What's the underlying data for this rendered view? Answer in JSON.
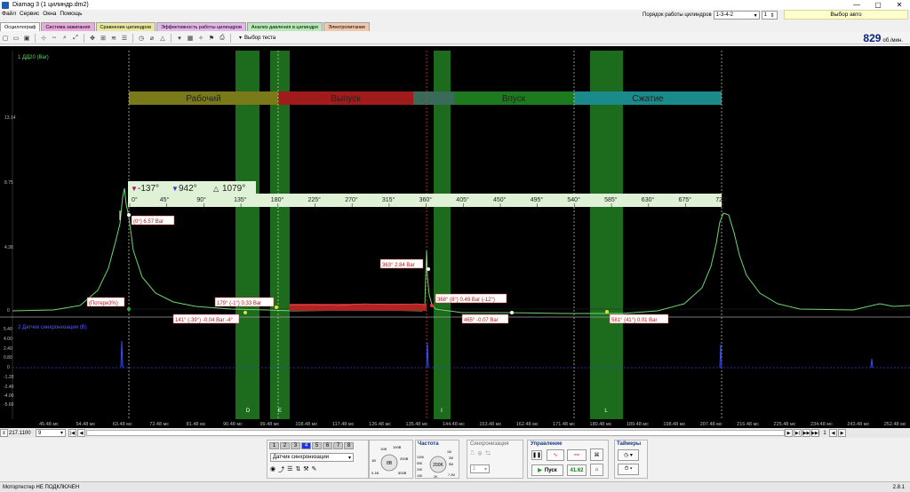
{
  "window": {
    "title": "Diamag 3 (1 цилиндр.dm2)",
    "controls": [
      "—",
      "▢",
      "✕"
    ]
  },
  "menu": [
    "Файл",
    "Сервис",
    "Окна",
    "Помощь"
  ],
  "cylinder_order": {
    "label": "Порядок работы цилиндров",
    "value": "1-3-4-2",
    "cylinder": "1",
    "auto_label": "Выбор авто"
  },
  "tabs": [
    {
      "label": "Осциллограф",
      "color": "#ffffff"
    },
    {
      "label": "Система зажигания",
      "color": "#e9a9dc"
    },
    {
      "label": "Сравнение цилиндров",
      "color": "#e8e8a0"
    },
    {
      "label": "Эффективность работы цилиндров",
      "color": "#e3b8e8"
    },
    {
      "label": "Анализ давления в цилиндре",
      "color": "#b8e8b8"
    },
    {
      "label": "Электропитание",
      "color": "#f0c8b0"
    }
  ],
  "toolbar": {
    "test_select": "Выбор теста"
  },
  "rpm": {
    "value": "829",
    "unit": "об./мин."
  },
  "scope": {
    "channel1_label": "1 ДД20 (Bar)",
    "channel2_label": "2 Датчик синхронизации (B)",
    "y1_ticks": [
      "13.14",
      "8.75",
      "4.38",
      "0"
    ],
    "y2_ticks": [
      "5.40",
      "4.00",
      "2.40",
      "0.80",
      "0",
      "-1.20",
      "-2.40",
      "-4.00",
      "-5.60"
    ],
    "phases": [
      {
        "label": "Рабочий",
        "color": "#7a7a1a"
      },
      {
        "label": "Выпуск",
        "color": "#a01c1c"
      },
      {
        "label": "Впуск",
        "color": "#1e7a1e"
      },
      {
        "label": "Сжатие",
        "color": "#1a8a8a"
      }
    ],
    "degree_scale": [
      "0°",
      "45°",
      "90°",
      "135°",
      "180°",
      "225°",
      "270°",
      "315°",
      "360°",
      "405°",
      "450°",
      "495°",
      "540°",
      "585°",
      "630°",
      "675°",
      "720°"
    ],
    "cursor_a": "-137°",
    "cursor_b": "942°",
    "delta": "1079°",
    "markers": [
      "D",
      "E",
      "I",
      "L"
    ],
    "annotations": [
      "(0°) 6.57 Bar",
      "(Потери3%)",
      "179° (-1°) 0.33 Bar",
      "141° (-39°) -0.04 Bar -4°",
      "363° 2.84 Bar",
      "368° (8°) 0.49 Bar (-12°)",
      "465° -0.07 Bar",
      "581° (41°) 0.01 Bar"
    ],
    "time_ticks": [
      "45.48 мс",
      "54.48 мс",
      "63.48 мс",
      "72.48 мс",
      "81.48 мс",
      "90.48 мс",
      "99.48 мс",
      "108.48 мс",
      "117.48 мс",
      "126.48 мс",
      "135.48 мс",
      "144.48 мс",
      "153.48 мс",
      "162.48 мс",
      "171.48 мс",
      "180.48 мс",
      "189.48 мс",
      "198.48 мс",
      "207.48 мс",
      "216.48 мс",
      "225.48 мс",
      "234.48 мс",
      "243.48 мс",
      "252.48 мс"
    ]
  },
  "scrollbar": {
    "zoom": "217.1100",
    "channels": "9",
    "page": "1"
  },
  "bottom": {
    "channel_buttons": [
      "1",
      "2",
      "3",
      "4",
      "5",
      "6",
      "7",
      "8"
    ],
    "sensor_select": "Датчик синхронизации",
    "voltage_knob": "8В",
    "voltage_labels": [
      "10В",
      "100В",
      "1В",
      "200В",
      "0.1В",
      "500В"
    ],
    "frequency_title": "Частота",
    "frequency_knob": "200K",
    "frequency_labels": [
      "100K",
      "1M",
      "50K",
      "2M",
      "20K",
      "5M",
      "10K",
      "2K",
      "7.2M"
    ],
    "sync_title": "Синхронизация",
    "sync_value": "1",
    "control_title": "Управление",
    "start_label": "Пуск",
    "control_value": "41.62",
    "timers_title": "Таймеры"
  },
  "status": {
    "text": "Мотортестер НЕ ПОДКЛЮЧЕН",
    "version": "2.8.1"
  }
}
